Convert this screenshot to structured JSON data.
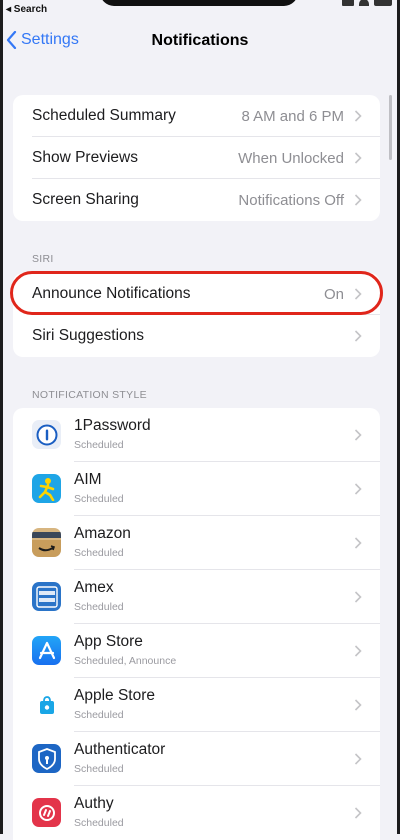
{
  "status_bar": {
    "back_label": "◂ Search"
  },
  "nav": {
    "back_label": "Settings",
    "title": "Notifications"
  },
  "top_group": [
    {
      "label": "Scheduled Summary",
      "value": "8 AM and 6 PM"
    },
    {
      "label": "Show Previews",
      "value": "When Unlocked"
    },
    {
      "label": "Screen Sharing",
      "value": "Notifications Off"
    }
  ],
  "siri": {
    "header": "SIRI",
    "announce": {
      "label": "Announce Notifications",
      "value": "On"
    },
    "suggestions": {
      "label": "Siri Suggestions"
    }
  },
  "notification_style": {
    "header": "NOTIFICATION STYLE",
    "apps": [
      {
        "name": "1Password",
        "subtitle": "Scheduled",
        "icon": "1password-icon"
      },
      {
        "name": "AIM",
        "subtitle": "Scheduled",
        "icon": "aim-icon"
      },
      {
        "name": "Amazon",
        "subtitle": "Scheduled",
        "icon": "amazon-icon"
      },
      {
        "name": "Amex",
        "subtitle": "Scheduled",
        "icon": "amex-icon"
      },
      {
        "name": "App Store",
        "subtitle": "Scheduled, Announce",
        "icon": "app-store-icon"
      },
      {
        "name": "Apple Store",
        "subtitle": "Scheduled",
        "icon": "apple-store-icon"
      },
      {
        "name": "Authenticator",
        "subtitle": "Scheduled",
        "icon": "authenticator-icon"
      },
      {
        "name": "Authy",
        "subtitle": "Scheduled",
        "icon": "authy-icon"
      }
    ]
  },
  "colors": {
    "accent": "#3478f6",
    "highlight_ring": "#e0261b",
    "background": "#f2f2f7"
  }
}
